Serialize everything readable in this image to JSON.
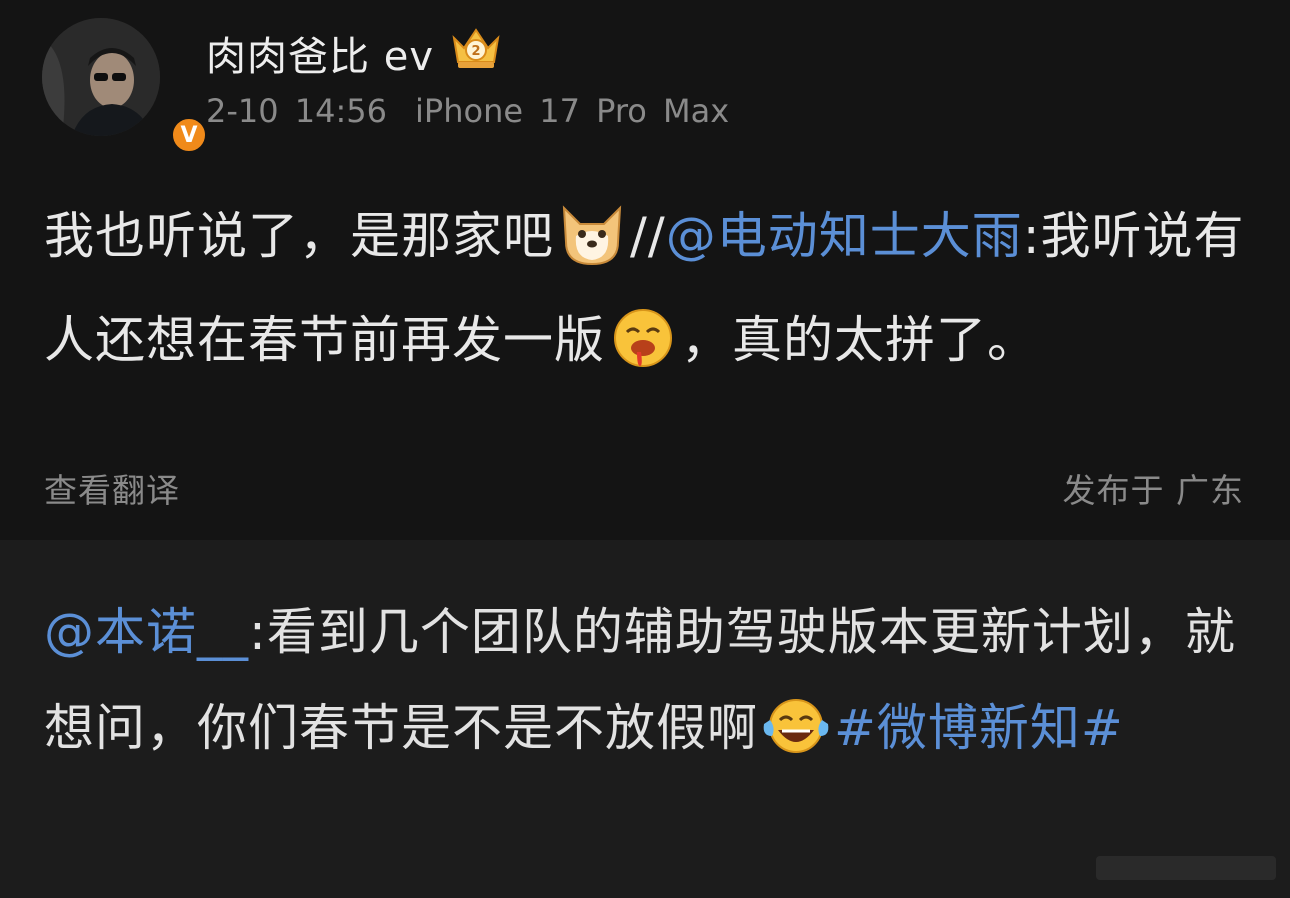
{
  "author": {
    "name": "肉肉爸比 ev",
    "badge": "crown-level-2-icon",
    "verified": "V",
    "date": "2-10 14:56",
    "device": "iPhone 17 Pro Max"
  },
  "post": {
    "part1": "我也听说了，是那家吧",
    "emoji1": "doge-icon",
    "sep": "//",
    "mention": "@电动知士大雨",
    "part2": ":我听说有人还想在春节前再发一版",
    "emoji2": "drooling-face-icon",
    "part3": "，真的太拼了。",
    "translate": "查看翻译",
    "location": "发布于 广东"
  },
  "repost": {
    "mention": "@本诺__",
    "text": ":看到几个团队的辅助驾驶版本更新计划，就想问，你们春节是不是不放假啊",
    "emoji": "laughing-tears-icon",
    "topic": "#微博新知#"
  },
  "colors": {
    "background": "#141414",
    "repost_background": "#1c1c1c",
    "link": "#5b8fd6",
    "muted": "#8a8a8a",
    "verified": "#f08a1a"
  }
}
